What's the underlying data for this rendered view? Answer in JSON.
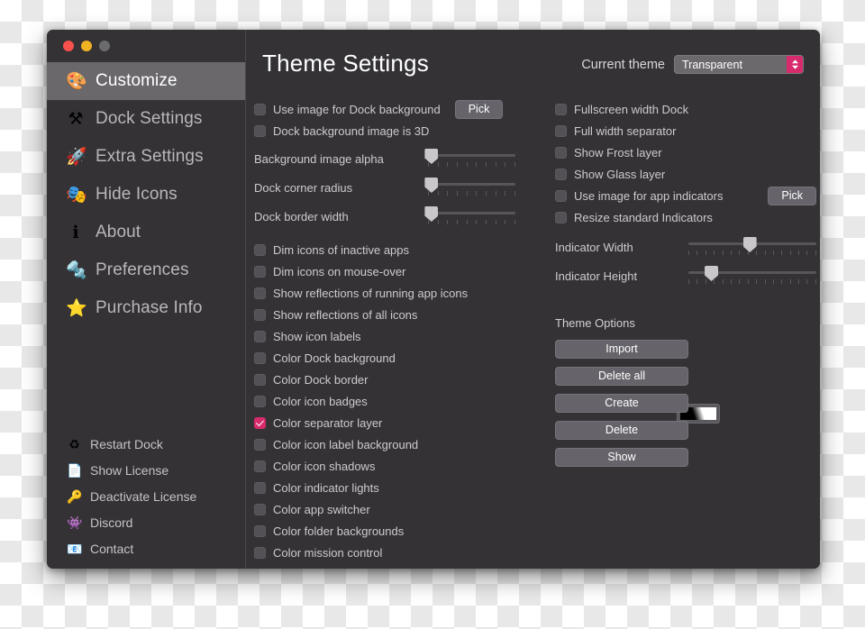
{
  "window": {
    "traffic_lights": [
      {
        "name": "close",
        "color": "#f8514b"
      },
      {
        "name": "minimize",
        "color": "#efb324"
      },
      {
        "name": "zoom",
        "color": "#6b6a6c"
      }
    ]
  },
  "sidebar": {
    "main_items": [
      {
        "label": "Customize",
        "icon": "palette-icon",
        "glyph": "🎨",
        "active": true
      },
      {
        "label": "Dock Settings",
        "icon": "hammer-icon",
        "glyph": "⚒",
        "active": false
      },
      {
        "label": "Extra Settings",
        "icon": "rocket-icon",
        "glyph": "🚀",
        "active": false
      },
      {
        "label": "Hide Icons",
        "icon": "theater-masks-icon",
        "glyph": "🎭",
        "active": false
      },
      {
        "label": "About",
        "icon": "info-icon",
        "glyph": "ℹ",
        "active": false
      },
      {
        "label": "Preferences",
        "icon": "screw-bolt-icon",
        "glyph": "🔩",
        "active": false
      },
      {
        "label": "Purchase Info",
        "icon": "star-icon",
        "glyph": "⭐",
        "active": false
      }
    ],
    "bottom_items": [
      {
        "label": "Restart Dock",
        "icon": "recycle-icon",
        "glyph": "♻"
      },
      {
        "label": "Show License",
        "icon": "page-icon",
        "glyph": "📄"
      },
      {
        "label": "Deactivate License",
        "icon": "key-icon",
        "glyph": "🔑"
      },
      {
        "label": "Discord",
        "icon": "discord-icon",
        "glyph": "👾"
      },
      {
        "label": "Contact",
        "icon": "email-icon",
        "glyph": "📧"
      }
    ]
  },
  "main": {
    "title": "Theme Settings",
    "current_theme_label": "Current theme",
    "current_theme_value": "Transparent",
    "theme_options_label": "Theme Options",
    "pick_label": "Pick",
    "left_column": {
      "checkboxes_top": [
        {
          "label": "Use image for Dock background",
          "checked": false,
          "has_pick": true
        },
        {
          "label": "Dock background image is 3D",
          "checked": false,
          "has_pick": false
        }
      ],
      "sliders": [
        {
          "label": "Background image alpha",
          "value_pct": 4
        },
        {
          "label": "Dock corner radius",
          "value_pct": 4
        },
        {
          "label": "Dock border width",
          "value_pct": 4
        }
      ],
      "checkboxes_bottom": [
        {
          "label": "Dim icons of inactive apps",
          "checked": false
        },
        {
          "label": "Dim icons on mouse-over",
          "checked": false
        },
        {
          "label": "Show reflections of running app icons",
          "checked": false
        },
        {
          "label": "Show reflections of all icons",
          "checked": false
        },
        {
          "label": "Show icon labels",
          "checked": false
        },
        {
          "label": "Color Dock background",
          "checked": false
        },
        {
          "label": "Color Dock border",
          "checked": false
        },
        {
          "label": "Color icon badges",
          "checked": false
        },
        {
          "label": "Color separator layer",
          "checked": true
        },
        {
          "label": "Color icon label background",
          "checked": false
        },
        {
          "label": "Color icon shadows",
          "checked": false
        },
        {
          "label": "Color indicator lights",
          "checked": false
        },
        {
          "label": "Color app switcher",
          "checked": false
        },
        {
          "label": "Color folder backgrounds",
          "checked": false
        },
        {
          "label": "Color mission control",
          "checked": false
        }
      ]
    },
    "right_column": {
      "checkboxes": [
        {
          "label": "Fullscreen width Dock",
          "checked": false,
          "has_pick": false
        },
        {
          "label": "Full width separator",
          "checked": false,
          "has_pick": false
        },
        {
          "label": "Show Frost layer",
          "checked": false,
          "has_pick": false
        },
        {
          "label": "Show Glass layer",
          "checked": false,
          "has_pick": false
        },
        {
          "label": "Use image for app indicators",
          "checked": false,
          "has_pick": true
        },
        {
          "label": "Resize standard Indicators",
          "checked": false,
          "has_pick": false
        }
      ],
      "sliders": [
        {
          "label": "Indicator Width",
          "value_pct": 48
        },
        {
          "label": "Indicator Height",
          "value_pct": 18
        }
      ],
      "buttons": [
        {
          "label": "Import"
        },
        {
          "label": "Delete all"
        },
        {
          "label": "Create"
        },
        {
          "label": "Delete"
        },
        {
          "label": "Show"
        }
      ]
    }
  },
  "colors": {
    "accent": "#d62a6d",
    "window_bg": "#343235",
    "sidebar_active": "#6a686b",
    "control_bg": "#66646a"
  }
}
